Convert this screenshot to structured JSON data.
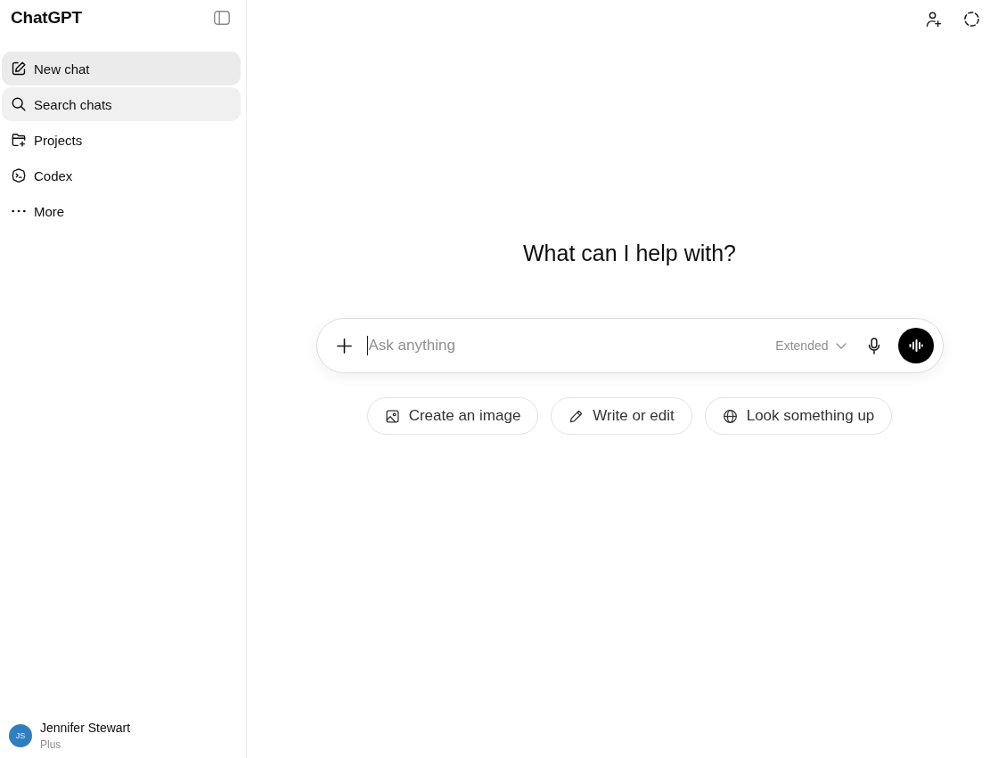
{
  "sidebar": {
    "logo": "ChatGPT",
    "items": [
      {
        "label": "New chat",
        "selected": true,
        "hovered": false
      },
      {
        "label": "Search chats",
        "selected": false,
        "hovered": true
      },
      {
        "label": "Projects",
        "selected": false,
        "hovered": false
      },
      {
        "label": "Codex",
        "selected": false,
        "hovered": false
      },
      {
        "label": "More",
        "selected": false,
        "hovered": false
      }
    ],
    "account": {
      "initials": "JS",
      "name": "Jennifer Stewart",
      "plan": "Plus"
    }
  },
  "main": {
    "heading": "What can I help with?",
    "composer": {
      "placeholder": "Ask anything",
      "focused": true,
      "mode": "Extended"
    },
    "suggestions": [
      {
        "label": "Create an image"
      },
      {
        "label": "Write or edit"
      },
      {
        "label": "Look something up"
      }
    ]
  }
}
